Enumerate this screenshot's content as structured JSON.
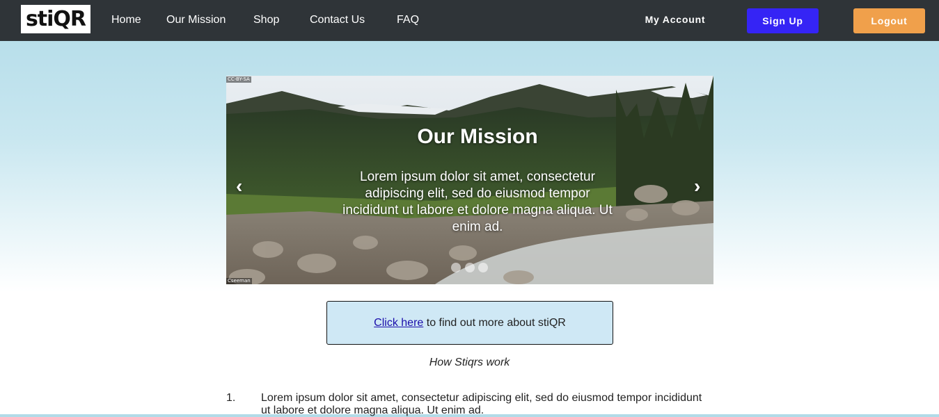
{
  "brand": {
    "logo_text": "stiQR"
  },
  "nav": {
    "links": [
      "Home",
      "Our Mission",
      "Shop",
      "Contact Us",
      "FAQ"
    ],
    "my_account": "My Account",
    "sign_up": "Sign Up",
    "logout": "Logout"
  },
  "colors": {
    "navbar": "#2f3438",
    "sign_up_button": "#3524f5",
    "logout_button": "#f0a04b",
    "info_box": "#cfe8f5"
  },
  "carousel": {
    "title": "Our Mission",
    "text": "Lorem ipsum dolor sit amet, consectetur adipiscing elit, sed do eiusmod tempor incididunt ut labore et dolore magna aliqua. Ut enim ad.",
    "prev_icon": "‹",
    "next_icon": "›",
    "slide_count": 3,
    "active_slide": 1
  },
  "info": {
    "link_text": "Click here",
    "rest_text": " to find out more about stiQR"
  },
  "section_heading": "How Stiqrs work",
  "steps": [
    {
      "number": "1.",
      "text": "Lorem ipsum dolor sit amet, consectetur adipiscing elit, sed do eiusmod tempor incididunt ut labore et dolore magna aliqua. Ut enim ad."
    }
  ]
}
